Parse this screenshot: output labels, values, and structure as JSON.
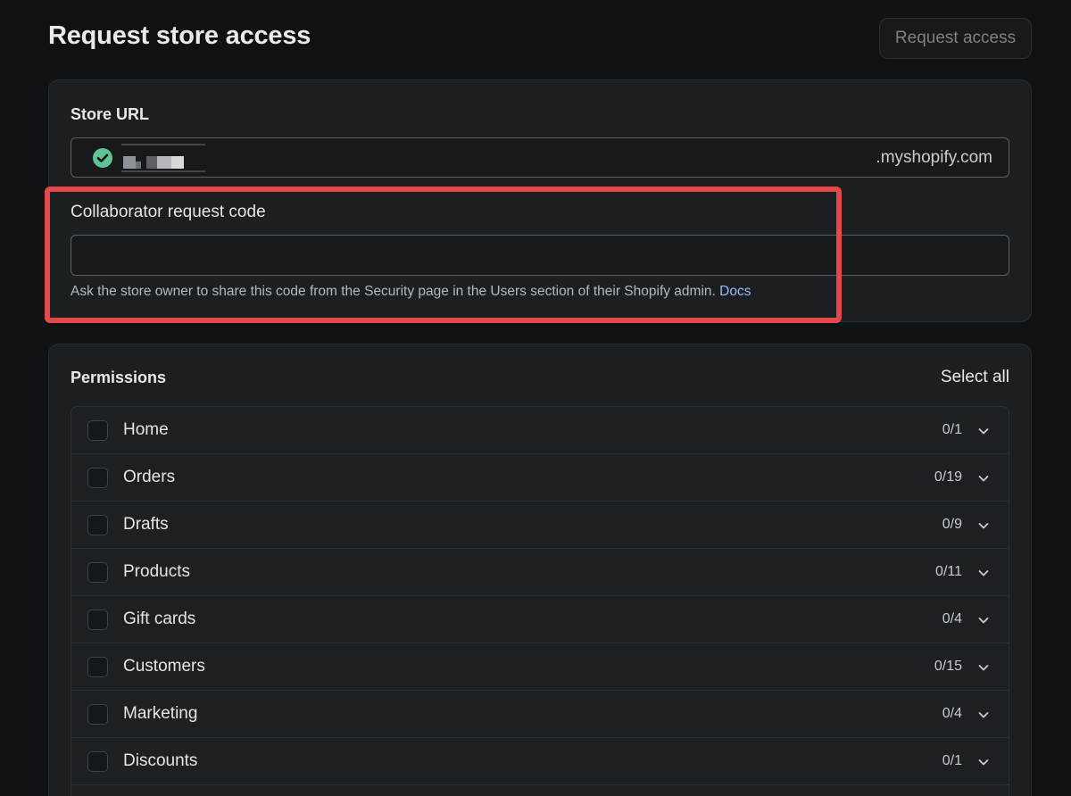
{
  "header": {
    "title": "Request store access",
    "request_button": "Request access"
  },
  "store": {
    "url_label": "Store URL",
    "url_suffix": ".myshopify.com",
    "collab_label": "Collaborator request code",
    "collab_value": "",
    "help_text": "Ask the store owner to share this code from the Security page in the Users section of their Shopify admin. ",
    "docs_link": "Docs"
  },
  "permissions": {
    "title": "Permissions",
    "select_all": "Select all",
    "items": [
      {
        "label": "Home",
        "count": "0/1"
      },
      {
        "label": "Orders",
        "count": "0/19"
      },
      {
        "label": "Drafts",
        "count": "0/9"
      },
      {
        "label": "Products",
        "count": "0/11"
      },
      {
        "label": "Gift cards",
        "count": "0/4"
      },
      {
        "label": "Customers",
        "count": "0/15"
      },
      {
        "label": "Marketing",
        "count": "0/4"
      },
      {
        "label": "Discounts",
        "count": "0/1"
      }
    ]
  },
  "colors": {
    "background": "#0f1214",
    "card": "#1b1f22",
    "success_icon": "#5fc495",
    "highlight": "#e54848",
    "link": "#9dbbf6"
  },
  "icons": {
    "verified": "check-circle-icon",
    "expand": "chevron-down-icon"
  }
}
